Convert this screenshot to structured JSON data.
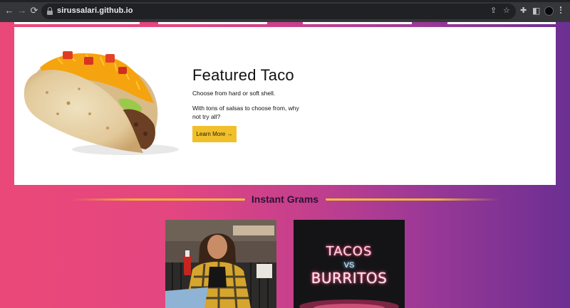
{
  "browser": {
    "url": "sirussalari.github.io",
    "icons": [
      "back-arrow-icon",
      "forward-arrow-icon",
      "reload-icon",
      "lock-icon",
      "share-icon",
      "bookmark-star-icon",
      "extensions-icon",
      "side-panel-icon",
      "profile-avatar",
      "menu-kebab-icon"
    ],
    "glyphs": {
      "back": "←",
      "forward": "→",
      "reload": "⟳",
      "share": "⇪",
      "star": "☆",
      "puzzle": "✚",
      "panel": "◧"
    }
  },
  "featured": {
    "title": "Featured Taco",
    "subtitle": "Choose from hard or soft shell.",
    "description": "With tons of salsas to choose from, why not try all?",
    "button_label": "Learn More →",
    "image": "taco-image"
  },
  "grams": {
    "title": "Instant Grams",
    "items": [
      {
        "image": "woman-with-hot-sauce-photo"
      },
      {
        "image": "tacos-vs-burritos-neon-sign-photo",
        "sign_line1": "TACOS",
        "sign_line2": "VS",
        "sign_line3": "BURRITOS"
      }
    ]
  },
  "colors": {
    "gradient_start": "#ea4878",
    "gradient_end": "#6b2f92",
    "button": "#f1bf2a",
    "divider": "#f0b432"
  }
}
